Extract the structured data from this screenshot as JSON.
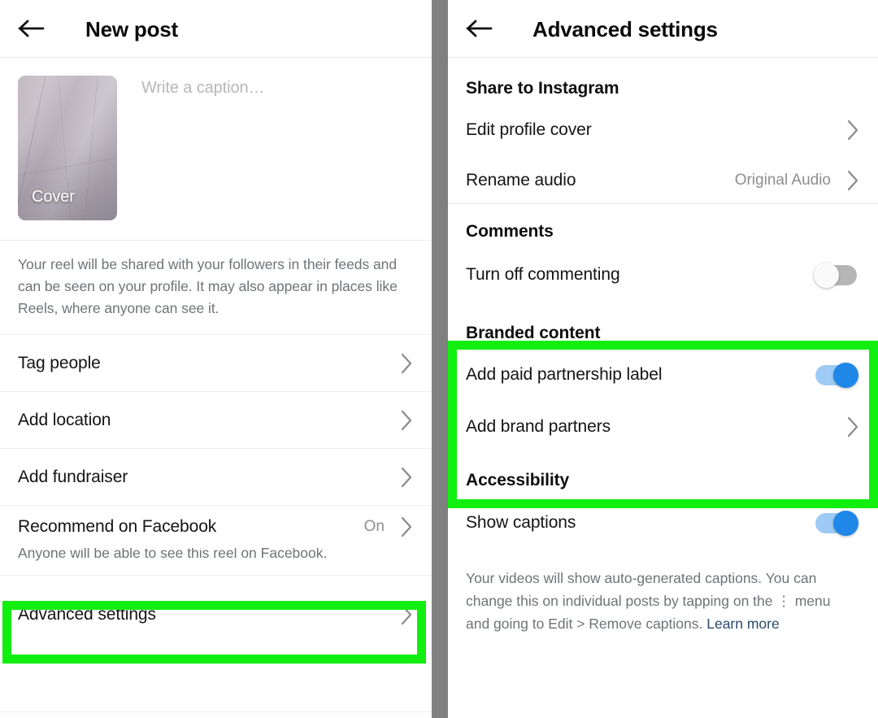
{
  "left_panel": {
    "header": {
      "back_icon": "arrow-left-icon",
      "title": "New post"
    },
    "compose": {
      "cover_label": "Cover",
      "caption_placeholder": "Write a caption…"
    },
    "share_note": "Your reel will be shared with your followers in their feeds and can be seen on your profile. It may also appear in places like Reels, where anyone can see it.",
    "rows": [
      {
        "label": "Tag people",
        "value": "",
        "chevron": true
      },
      {
        "label": "Add location",
        "value": "",
        "chevron": true
      },
      {
        "label": "Add fundraiser",
        "value": "",
        "chevron": true
      },
      {
        "label": "Recommend on Facebook",
        "value": "On",
        "chevron": true
      },
      {
        "label": "Advanced settings",
        "value": "",
        "chevron": true
      }
    ],
    "facebook_subnote": "Anyone will be able to see this reel on Facebook.",
    "highlight_target": "Advanced settings"
  },
  "right_panel": {
    "header": {
      "back_icon": "arrow-left-icon",
      "title": "Advanced settings"
    },
    "sections": [
      {
        "heading": "Share to Instagram",
        "rows": [
          {
            "label": "Edit profile cover",
            "value": "",
            "control": "chevron"
          },
          {
            "label": "Rename audio",
            "value": "Original Audio",
            "control": "chevron"
          }
        ]
      },
      {
        "heading": "Comments",
        "rows": [
          {
            "label": "Turn off commenting",
            "value": "",
            "control": "toggle",
            "toggle_state": "off"
          }
        ]
      },
      {
        "heading": "Branded content",
        "highlighted": true,
        "rows": [
          {
            "label": "Add paid partnership label",
            "value": "",
            "control": "toggle",
            "toggle_state": "on"
          },
          {
            "label": "Add brand partners",
            "value": "",
            "control": "chevron"
          }
        ]
      },
      {
        "heading": "Accessibility",
        "rows": [
          {
            "label": "Show captions",
            "value": "",
            "control": "toggle",
            "toggle_state": "on"
          }
        ]
      }
    ],
    "captions_note_part1": "Your videos will show auto-generated captions. You can change this on individual posts by tapping on the ",
    "captions_note_menu_icon": "⋮",
    "captions_note_part2": " menu and going to Edit > Remove captions. ",
    "captions_learn_more": "Learn more"
  },
  "colors": {
    "highlight_green": "#11ef11",
    "toggle_on_knob": "#1f87e8",
    "toggle_on_track": "#9ecbf5",
    "toggle_off_track": "#b6b6b6",
    "divider_grey": "#808080",
    "link_blue": "#2a4a6b"
  }
}
